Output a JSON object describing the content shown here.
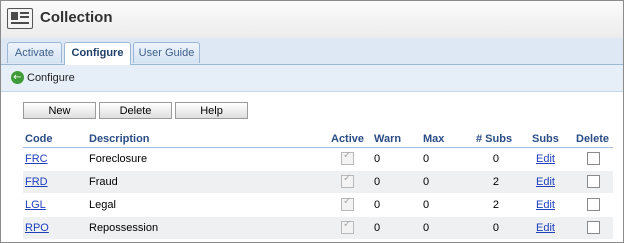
{
  "app": {
    "title": "Collection",
    "icon": "id-card-icon"
  },
  "tabs": [
    {
      "label": "Activate",
      "active": false
    },
    {
      "label": "Configure",
      "active": true
    },
    {
      "label": "User Guide",
      "active": false
    }
  ],
  "breadcrumb": {
    "icon": "back-arrow-icon",
    "label": "Configure"
  },
  "toolbar": {
    "new_label": "New",
    "delete_label": "Delete",
    "help_label": "Help"
  },
  "table": {
    "headers": {
      "code": "Code",
      "description": "Description",
      "active": "Active",
      "warn": "Warn",
      "max": "Max",
      "subs_count": "# Subs",
      "subs": "Subs",
      "delete": "Delete"
    },
    "rows": [
      {
        "code": "FRC",
        "description": "Foreclosure",
        "active": true,
        "warn": "0",
        "max": "0",
        "subs_count": "0",
        "subs_action": "Edit",
        "delete": false
      },
      {
        "code": "FRD",
        "description": "Fraud",
        "active": true,
        "warn": "0",
        "max": "0",
        "subs_count": "2",
        "subs_action": "Edit",
        "delete": false
      },
      {
        "code": "LGL",
        "description": "Legal",
        "active": true,
        "warn": "0",
        "max": "0",
        "subs_count": "2",
        "subs_action": "Edit",
        "delete": false
      },
      {
        "code": "RPO",
        "description": "Repossession",
        "active": true,
        "warn": "0",
        "max": "0",
        "subs_count": "0",
        "subs_action": "Edit",
        "delete": false
      }
    ]
  }
}
